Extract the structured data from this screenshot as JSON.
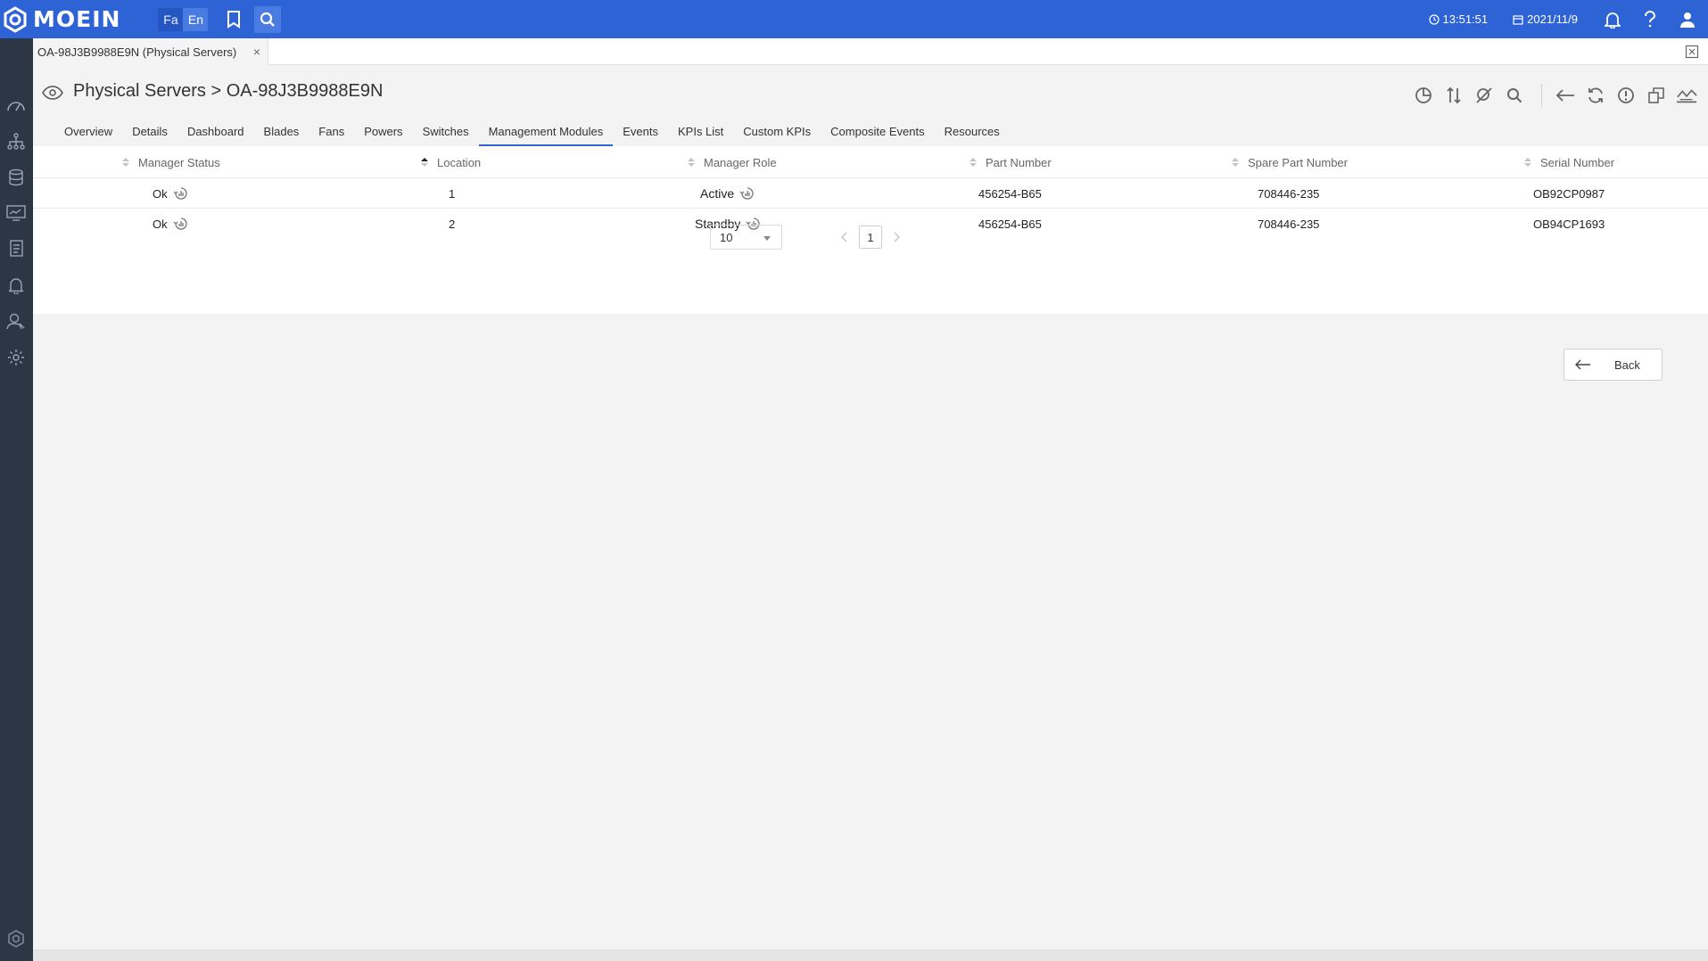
{
  "brand": {
    "name": "MOEIN"
  },
  "header": {
    "lang_fa": "Fa",
    "lang_en": "En",
    "time": "13:51:51",
    "date": "2021/11/9"
  },
  "doc_tab": {
    "label": "OA-98J3B9988E9N (Physical Servers)",
    "close": "×"
  },
  "page": {
    "title": "Physical Servers > OA-98J3B9988E9N"
  },
  "tabs": [
    {
      "label": "Overview"
    },
    {
      "label": "Details"
    },
    {
      "label": "Dashboard"
    },
    {
      "label": "Blades"
    },
    {
      "label": "Fans"
    },
    {
      "label": "Powers"
    },
    {
      "label": "Switches"
    },
    {
      "label": "Management Modules",
      "active": true
    },
    {
      "label": "Events"
    },
    {
      "label": "KPIs List"
    },
    {
      "label": "Custom KPIs"
    },
    {
      "label": "Composite Events"
    },
    {
      "label": "Resources"
    }
  ],
  "table": {
    "columns": [
      "Manager Status",
      "Location",
      "Manager Role",
      "Part Number",
      "Spare Part Number",
      "Serial Number"
    ],
    "sorted_column": "Location",
    "rows": [
      {
        "status": "Ok",
        "location": "1",
        "role": "Active",
        "part": "456254-B65",
        "spare": "708446-235",
        "serial": "OB92CP0987"
      },
      {
        "status": "Ok",
        "location": "2",
        "role": "Standby",
        "part": "456254-B65",
        "spare": "708446-235",
        "serial": "OB94CP1693"
      }
    ]
  },
  "pagination": {
    "page_size": "10",
    "current_page": "1"
  },
  "back_button": {
    "label": "Back"
  },
  "colors": {
    "header": "#2e63d6",
    "sidebar": "#2c3644",
    "accent": "#2e63d6"
  },
  "icons": {
    "sidebar": [
      "dashboard-gauge-icon",
      "topology-icon",
      "database-icon",
      "monitor-chart-icon",
      "reports-icon",
      "bell-icon",
      "users-icon",
      "settings-icon",
      "brand-logo-icon"
    ],
    "toolbar": [
      "pie-chart-icon",
      "sort-icon",
      "alarm-off-icon",
      "search-icon",
      "back-arrow-icon",
      "refresh-icon",
      "info-icon",
      "copy-icon",
      "trend-icon"
    ]
  }
}
